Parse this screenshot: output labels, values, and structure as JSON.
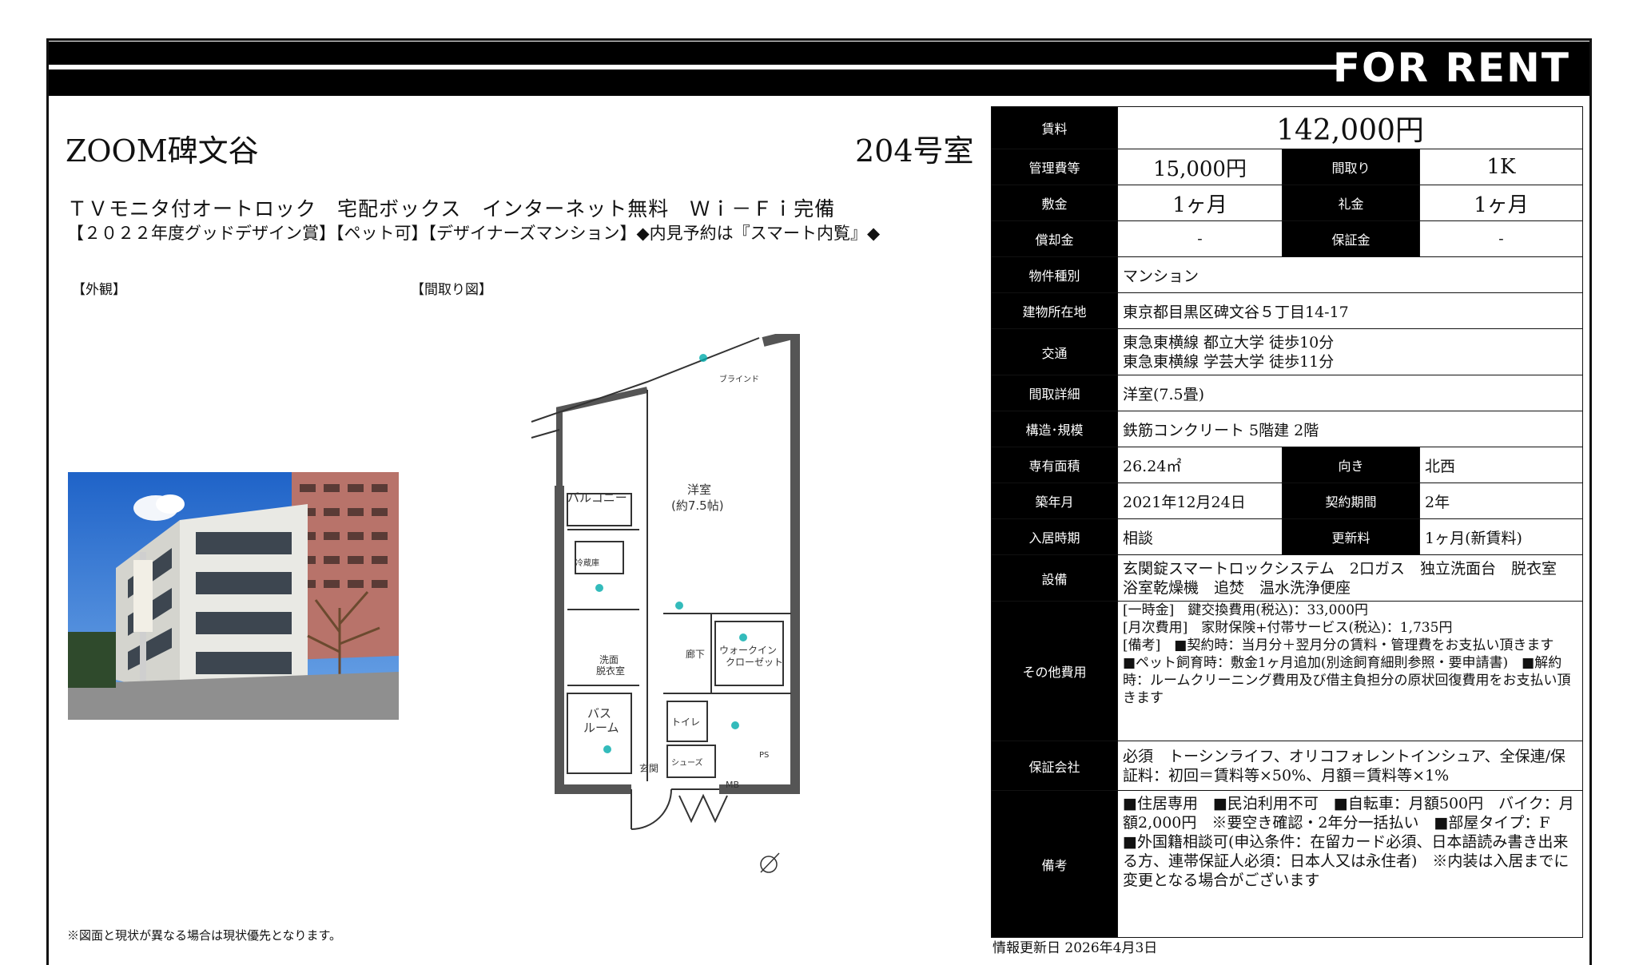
{
  "banner": {
    "label": "FOR RENT"
  },
  "property": {
    "name": "ZOOM碑文谷",
    "room": "204号室",
    "catch1": "ＴＶモニタ付オートロック　宅配ボックス　インターネット無料　Ｗｉ－Ｆｉ完備",
    "catch2": "【２０２２年度グッドデザイン賞】【ペット可】【デザイナーズマンション】◆内見予約は『スマート内覧』◆"
  },
  "images": {
    "exterior_label": "【外観】",
    "floorplan_label": "【間取り図】",
    "floorplan_texts": {
      "balcony": "バルコニー",
      "room": "洋室",
      "room_size": "(約7.5帖)",
      "walkin": "ウォークイン",
      "closet": "クローゼット",
      "bath": "バス",
      "bath2": "ルーム",
      "washroom": "洗面",
      "washroom2": "脱衣室",
      "corridor": "廊下",
      "toilet": "トイレ",
      "entrance": "玄関",
      "shoebox": "シューズ",
      "mb": "MB",
      "ps": "PS",
      "blind": "ブラインド",
      "fridge": "冷蔵庫"
    }
  },
  "spec": {
    "rent_label": "賃料",
    "rent": "142,000円",
    "mgmt_label": "管理費等",
    "mgmt": "15,000円",
    "layout_label": "間取り",
    "layout": "1K",
    "deposit_label": "敷金",
    "deposit": "1ヶ月",
    "key_money_label": "礼金",
    "key_money": "1ヶ月",
    "amort_label": "償却金",
    "amort": "-",
    "guarantee_dep_label": "保証金",
    "guarantee_dep": "-",
    "type_label": "物件種別",
    "type": "マンション",
    "address_label": "建物所在地",
    "address": "東京都目黒区碑文谷５丁目14-17",
    "transit_label": "交通",
    "transit1": "東急東横線 都立大学 徒歩10分",
    "transit2": "東急東横線 学芸大学 徒歩11分",
    "room_detail_label": "間取詳細",
    "room_detail": "洋室(7.5畳)",
    "structure_label": "構造･規模",
    "structure": "鉄筋コンクリート 5階建 2階",
    "area_label": "専有面積",
    "area": "26.24㎡",
    "direction_label": "向き",
    "direction": "北西",
    "built_label": "築年月",
    "built": "2021年12月24日",
    "contract_label": "契約期間",
    "contract": "2年",
    "movein_label": "入居時期",
    "movein": "相談",
    "renewal_label": "更新料",
    "renewal": "1ヶ月(新賃料)",
    "facilities_label": "設備",
    "facilities": "玄関錠スマートロックシステム　2口ガス　独立洗面台　脱衣室　浴室乾燥機　追焚　温水洗浄便座",
    "other_label": "その他費用",
    "other1": "[一時金]　鍵交換費用(税込)：33,000円",
    "other2": "[月次費用]　家財保険+付帯サービス(税込)：1,735円",
    "other3": "[備考]　■契約時：当月分＋翌月分の賃料・管理費をお支払い頂きます　■ペット飼育時：敷金1ヶ月追加(別途飼育細則参照・要申請書)　■解約時：ルームクリーニング費用及び借主負担分の原状回復費用をお支払い頂きます",
    "guarantor_label": "保証会社",
    "guarantor": "必須　トーシンライフ、オリコフォレントインシュア、全保連/保証料：初回＝賃料等×50%、月額＝賃料等×1%",
    "remarks_label": "備考",
    "remarks": "■住居専用　■民泊利用不可　■自転車：月額500円　バイク：月額2,000円　※要空き確認・2年分一括払い　■部屋タイプ：F　■外国籍相談可(申込条件：在留カード必須、日本語読み書き出来る方、連帯保証人必須：日本人又は永住者)　※内装は入居までに変更となる場合がございます"
  },
  "footer": {
    "note": "※図面と現状が異なる場合は現状優先となります。",
    "updated": "情報更新日 2026年4月3日"
  }
}
